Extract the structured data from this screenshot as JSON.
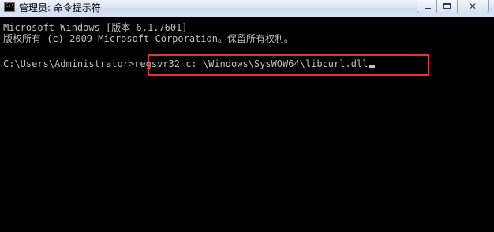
{
  "window": {
    "title": "管理员: 命令提示符",
    "icon_label": "C:\\",
    "controls": {
      "minimize": "minimize-icon",
      "maximize": "maximize-icon",
      "close": "close-icon",
      "close_glyph": "✕"
    }
  },
  "console": {
    "lines": [
      "Microsoft Windows [版本 6.1.7601]",
      "版权所有 (c) 2009 Microsoft Corporation。保留所有权利。"
    ],
    "prompt": "C:\\Users\\Administrator>",
    "command": "regsvr32 c: \\Windows\\SysWOW64\\libcurl.dll",
    "highlight_color": "#e8322f"
  }
}
